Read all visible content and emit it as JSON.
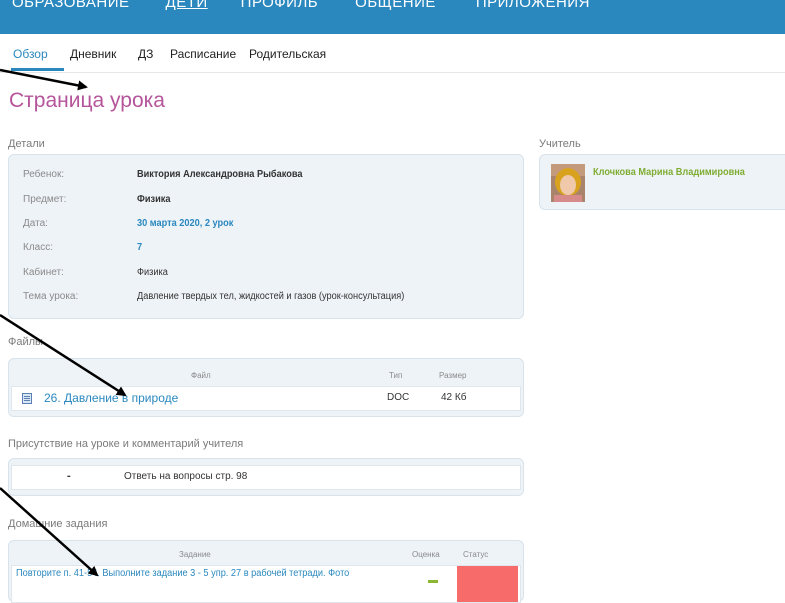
{
  "topnav": [
    "ОБРАЗОВАНИЕ",
    "ДЕТИ",
    "ПРОФИЛЬ",
    "ОБЩЕНИЕ",
    "ПРИЛОЖЕНИЯ"
  ],
  "subnav": [
    "Обзор",
    "Дневник",
    "ДЗ",
    "Расписание",
    "Родительская"
  ],
  "page_title": "Страница урока",
  "details": {
    "title": "Детали",
    "rows": [
      {
        "k": "Ребенок:",
        "v": "Виктория Александровна Рыбакова"
      },
      {
        "k": "Предмет:",
        "v": "Физика"
      },
      {
        "k": "Дата:",
        "v": "30 марта 2020, 2 урок"
      },
      {
        "k": "Класс:",
        "v": "7"
      },
      {
        "k": "Кабинет:",
        "v": "Физика"
      },
      {
        "k": "Тема урока:",
        "v": "Давление твердых тел, жидкостей и газов (урок-консультация)"
      }
    ]
  },
  "teacher": {
    "title": "Учитель",
    "name": "Клочкова Марина Владимировна"
  },
  "files": {
    "title": "Файлы",
    "headers": [
      "Файл",
      "Тип",
      "Размер"
    ],
    "rows": [
      {
        "name": "26. Давление в природе",
        "type": "DOC",
        "size": "42 Кб"
      }
    ]
  },
  "attendance": {
    "title": "Присутствие на уроке и комментарий учителя",
    "mark": "-",
    "comment": "Ответь на вопросы стр. 98"
  },
  "homework": {
    "title": "Домашние задания",
    "headers": [
      "Задание",
      "Оценка",
      "Статус"
    ],
    "row": "Повторите п. 41-54. Выполните задание 3 - 5 упр. 27 в рабочей тетради. Фото"
  },
  "colors": {
    "accent": "#2a88bf",
    "title": "#b5559b",
    "teacher_name": "#7fad32",
    "status_red": "#f76b6b"
  }
}
